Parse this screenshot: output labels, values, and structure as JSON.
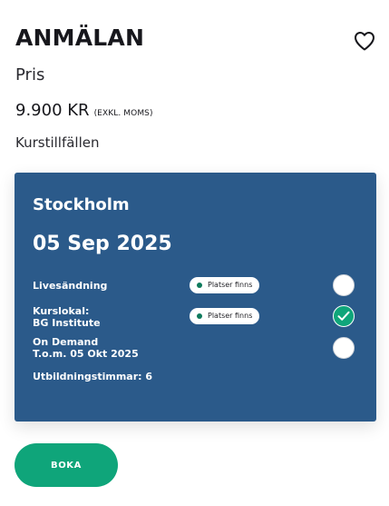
{
  "course": {
    "title": "ANMÄLAN",
    "price_label": "Pris",
    "price_value": "9.900 KR",
    "price_note": "(EXKL. MOMS)",
    "sessions_label": "Kurstillfällen"
  },
  "favorite": {
    "icon": "heart-icon"
  },
  "session": {
    "city": "Stockholm",
    "date": "05 Sep 2025",
    "options": [
      {
        "label_lines": [
          "Livesändning"
        ],
        "availability": "Platser finns",
        "selected": false
      },
      {
        "label_lines": [
          "Kurslokal:",
          "BG Institute"
        ],
        "availability": "Platser finns",
        "selected": true
      },
      {
        "label_lines": [
          "On Demand",
          "T.o.m. 05 Okt 2025"
        ],
        "availability": "",
        "selected": false
      }
    ],
    "training_hours": "Utbildningstimmar: 6"
  },
  "actions": {
    "book_label": "BOKA"
  },
  "colors": {
    "card_background": "#2b5a8a",
    "accent_green": "#0fa57a",
    "availability_dot": "#0e7a5c"
  }
}
